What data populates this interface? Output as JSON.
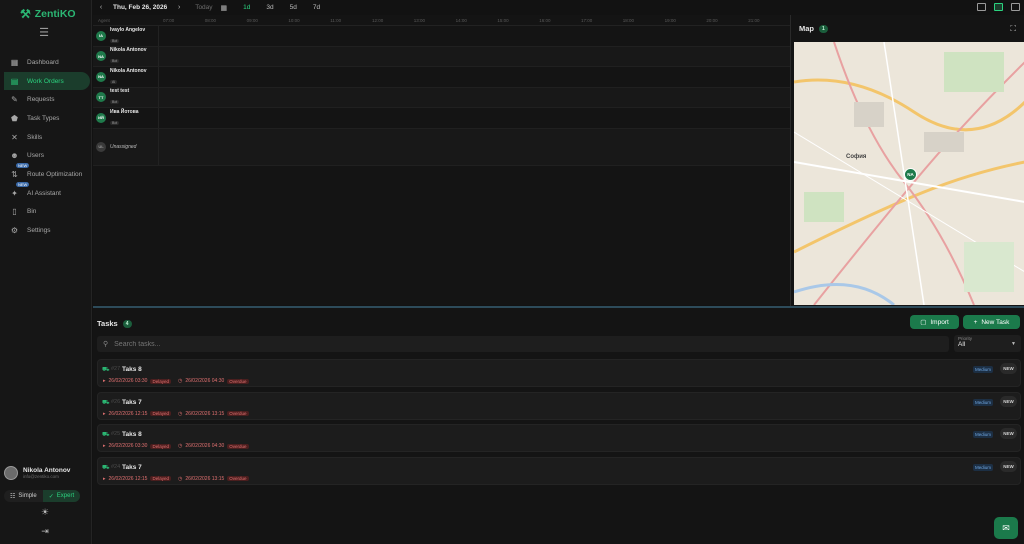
{
  "app": {
    "brand": "ZentiKO"
  },
  "sidebar": {
    "items": [
      {
        "label": "Dashboard",
        "icon": "grid-icon"
      },
      {
        "label": "Work Orders",
        "icon": "clipboard-icon",
        "active": true
      },
      {
        "label": "Requests",
        "icon": "wrench-icon"
      },
      {
        "label": "Task Types",
        "icon": "shapes-icon"
      },
      {
        "label": "Skills",
        "icon": "tools-icon"
      },
      {
        "label": "Users",
        "icon": "users-icon"
      },
      {
        "label": "Route Optimization",
        "icon": "route-icon",
        "badge": "NEW"
      },
      {
        "label": "AI Assistant",
        "icon": "sparkle-icon",
        "badge": "NEW"
      },
      {
        "label": "Bin",
        "icon": "trash-icon"
      },
      {
        "label": "Settings",
        "icon": "gear-icon"
      }
    ],
    "user": {
      "name": "Nikola Antonov",
      "email": "info@zentiko.com"
    },
    "mode": {
      "simple": "Simple",
      "expert": "Expert"
    }
  },
  "topbar": {
    "date": "Thu, Feb 26, 2026",
    "today": "Today",
    "ranges": [
      "1d",
      "3d",
      "5d",
      "7d"
    ]
  },
  "scheduler": {
    "agent_header": "Agent",
    "ticks": [
      "07:00",
      "08:00",
      "09:00",
      "10:00",
      "11:00",
      "12:00",
      "13:00",
      "14:00",
      "15:00",
      "16:00",
      "17:00",
      "18:00",
      "19:00",
      "20:00",
      "21:00"
    ],
    "agents": [
      {
        "initials": "IA",
        "name": "Ivaylo Angelov",
        "tag": "Bot"
      },
      {
        "initials": "NA",
        "name": "Nikola Antonov",
        "tag": "Bot"
      },
      {
        "initials": "NA",
        "name": "Nikola Antonov",
        "tag": "Ai"
      },
      {
        "initials": "TT",
        "name": "test test",
        "tag": "Bot"
      },
      {
        "initials": "ИЙ",
        "name": "Ива Йотова",
        "tag": "Bot"
      },
      {
        "initials": "UL",
        "name": "Unassigned",
        "tag": ""
      }
    ]
  },
  "map": {
    "title": "Map",
    "count": "1",
    "pin": "NA",
    "city": "София"
  },
  "tasks": {
    "title": "Tasks",
    "count": "4",
    "import_label": "Import",
    "new_label": "New Task",
    "search_placeholder": "Search tasks...",
    "priority_label": "Priority",
    "priority_value": "All",
    "items": [
      {
        "num": "#27",
        "name": "Taks 8",
        "start": "26/02/2026 03:30",
        "end": "26/02/2026 04:30",
        "delayed": "Delayed",
        "overdue": "Overdue",
        "priority": "Medium",
        "status": "NEW"
      },
      {
        "num": "#26",
        "name": "Taks 7",
        "start": "26/02/2026 12:15",
        "end": "26/02/2026 13:15",
        "delayed": "Delayed",
        "overdue": "Overdue",
        "priority": "Medium",
        "status": "NEW"
      },
      {
        "num": "#25",
        "name": "Taks 8",
        "start": "26/02/2026 03:30",
        "end": "26/02/2026 04:30",
        "delayed": "Delayed",
        "overdue": "Overdue",
        "priority": "Medium",
        "status": "NEW"
      },
      {
        "num": "#24",
        "name": "Taks 7",
        "start": "26/02/2026 12:15",
        "end": "26/02/2026 13:15",
        "delayed": "Delayed",
        "overdue": "Overdue",
        "priority": "Medium",
        "status": "NEW"
      }
    ]
  },
  "colors": {
    "accent": "#2bd37f",
    "brand": "#1b7a4b",
    "danger": "#e07070"
  }
}
